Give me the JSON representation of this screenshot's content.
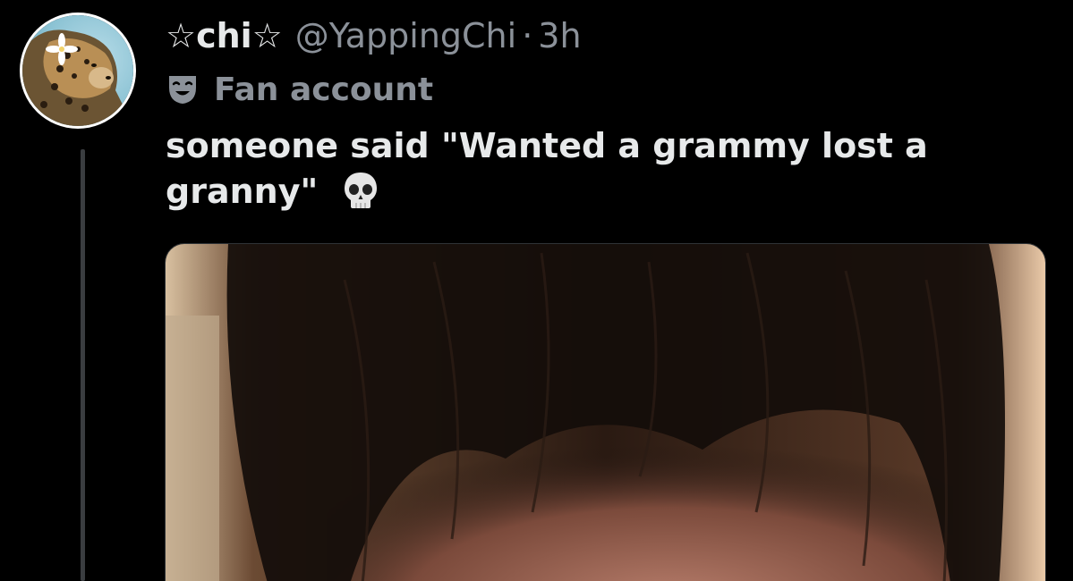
{
  "tweet": {
    "display_name": "☆chi☆",
    "handle": "@YappingChi",
    "separator": "·",
    "time": "3h",
    "account_label": "Fan account",
    "text_main": "someone said \"Wanted a grammy lost a granny\"",
    "emoji": "skull-emoji",
    "avatar_icon": "leopard-avatar",
    "label_icon": "theater-mask-icon",
    "media": "photo"
  },
  "colors": {
    "background": "#000000",
    "primary_text": "#e7e9ea",
    "secondary_text": "#8b9199",
    "thread_line": "#3a3d40"
  }
}
